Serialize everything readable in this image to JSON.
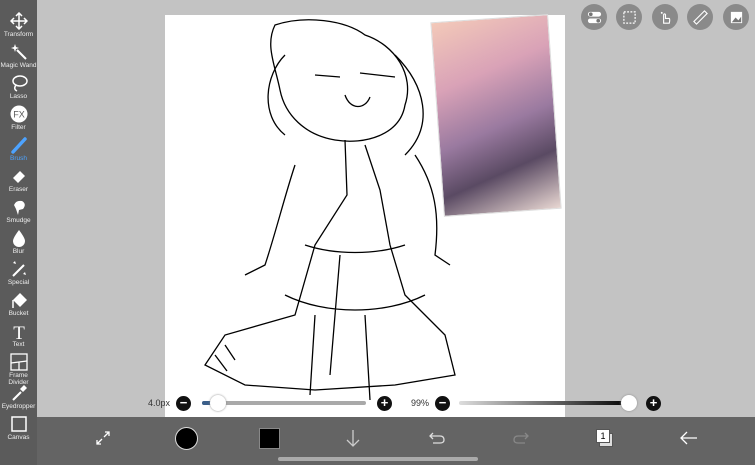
{
  "sidebar": {
    "tools": [
      {
        "label": "Transform",
        "icon": "move-icon"
      },
      {
        "label": "Magic Wand",
        "icon": "magic-wand-icon"
      },
      {
        "label": "Lasso",
        "icon": "lasso-icon"
      },
      {
        "label": "Filter",
        "icon": "fx-icon"
      },
      {
        "label": "Brush",
        "icon": "brush-icon",
        "active": true
      },
      {
        "label": "Eraser",
        "icon": "eraser-icon"
      },
      {
        "label": "Smudge",
        "icon": "smudge-icon"
      },
      {
        "label": "Blur",
        "icon": "blur-drop-icon"
      },
      {
        "label": "Special",
        "icon": "special-icon"
      },
      {
        "label": "Bucket",
        "icon": "bucket-icon"
      },
      {
        "label": "Text",
        "icon": "text-icon"
      },
      {
        "label": "Frame Divider",
        "icon": "frame-divider-icon"
      },
      {
        "label": "Eyedropper",
        "icon": "eyedropper-icon"
      },
      {
        "label": "Canvas",
        "icon": "canvas-icon"
      }
    ]
  },
  "fx_glyph": "FX",
  "text_glyph": "T",
  "brush": {
    "size_label": "4.0px",
    "size_fraction": 0.04,
    "opacity_label": "99%",
    "opacity_fraction": 0.99
  },
  "color": {
    "primary": "#000000",
    "accent": "#4da3ff"
  },
  "layers": {
    "count": "1"
  }
}
